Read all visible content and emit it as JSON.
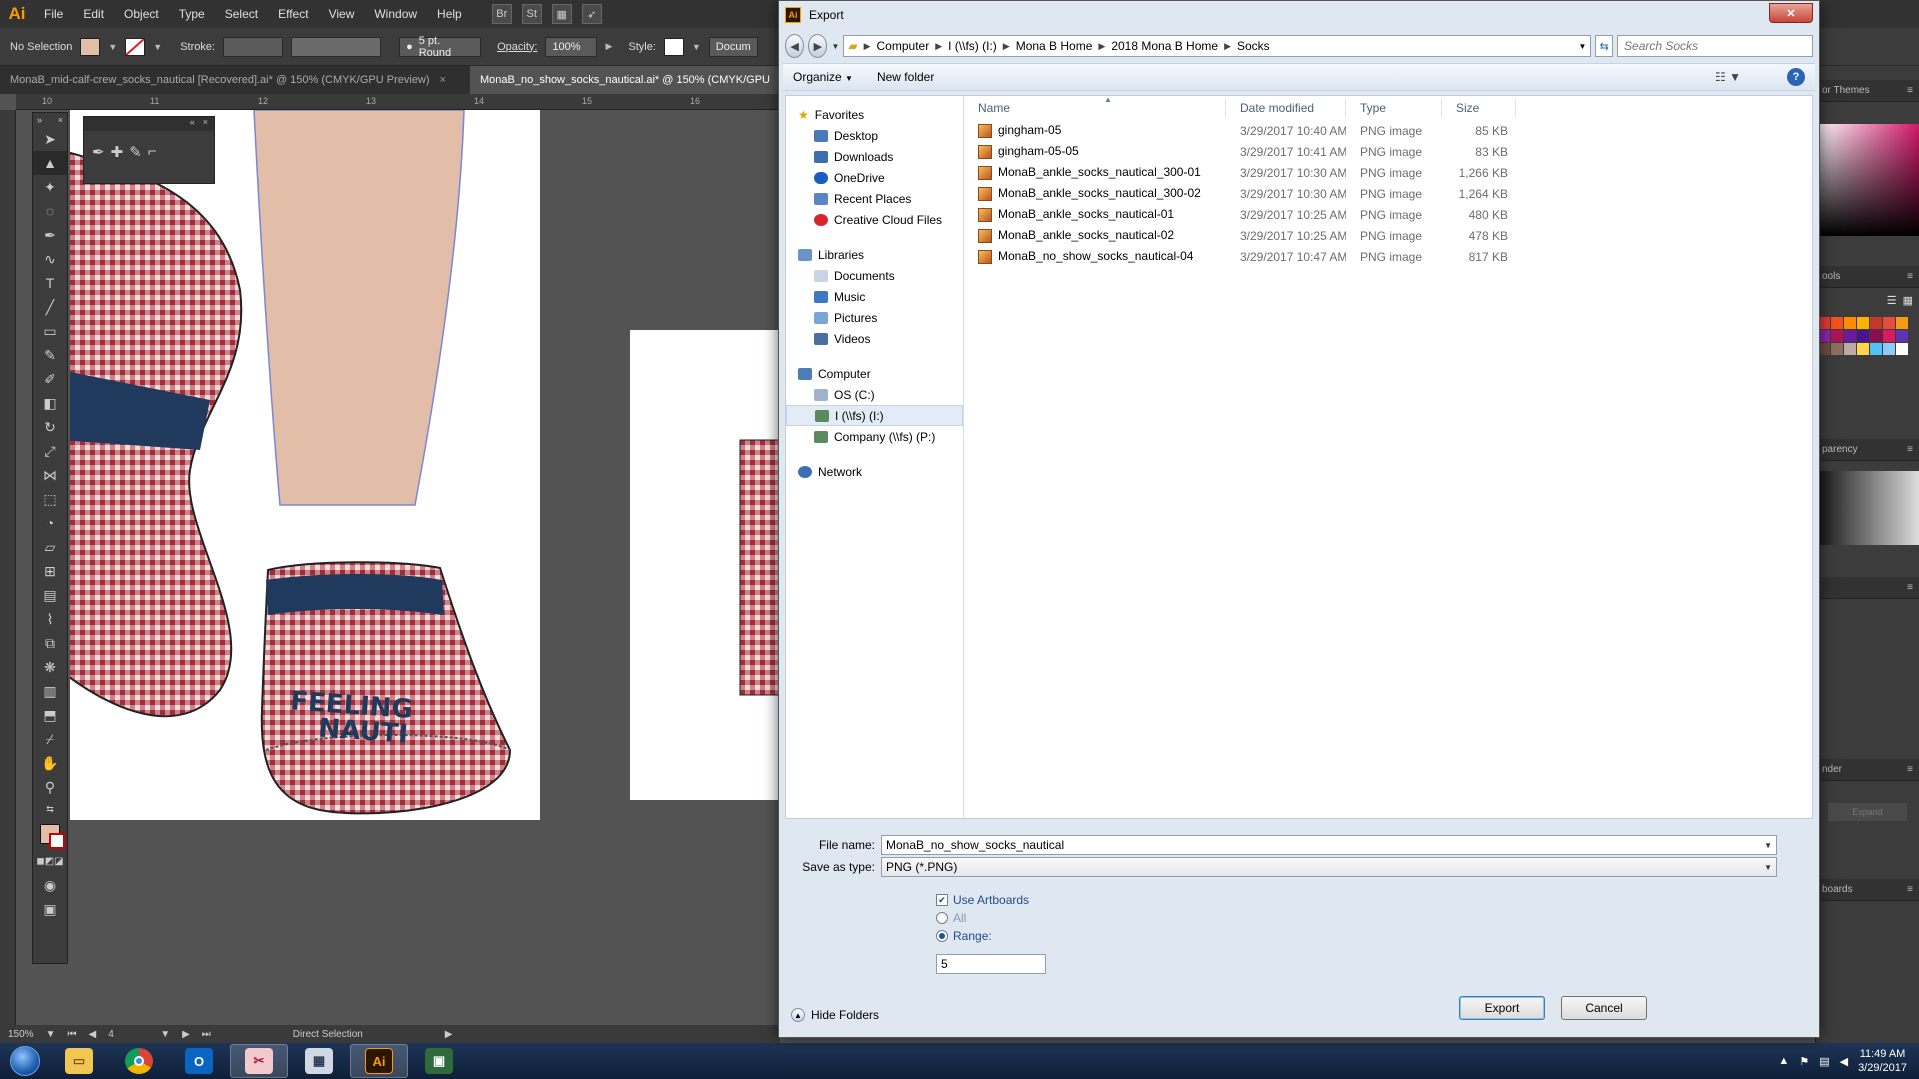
{
  "illustrator": {
    "logo": "Ai",
    "menus": [
      "File",
      "Edit",
      "Object",
      "Type",
      "Select",
      "Effect",
      "View",
      "Window",
      "Help"
    ],
    "bar_icons": [
      "Br",
      "St"
    ],
    "control": {
      "selection": "No Selection",
      "stroke_label": "Stroke:",
      "brush": "5 pt. Round",
      "opacity_label": "Opacity:",
      "opacity_value": "100%",
      "style_label": "Style:",
      "doc_label": "Docum"
    },
    "tabs": [
      {
        "label": "MonaB_mid-calf-crew_socks_nautical [Recovered].ai* @ 150% (CMYK/GPU Preview)"
      },
      {
        "label": "MonaB_no_show_socks_nautical.ai* @ 150% (CMYK/GPU"
      }
    ],
    "ruler_numbers": [
      "10",
      "11",
      "12",
      "13",
      "14",
      "15",
      "16"
    ],
    "artwork_text": [
      "FEELING",
      "NAUTI"
    ],
    "status": {
      "zoom": "150%",
      "artboard_number": "4",
      "tool_name": "Direct Selection"
    },
    "dock_panels": [
      "or Themes",
      "ools",
      "parency",
      "nder",
      "boards"
    ],
    "dock_expand": "Expand",
    "colors": {
      "gingham": "#b5454f",
      "cuff": "#1f3a5c",
      "skin": "#e2bea8",
      "app_bg": "#535353"
    }
  },
  "dialog": {
    "title": "Export",
    "app_icon": "Ai",
    "breadcrumb": [
      "Computer",
      "I (\\\\fs) (I:)",
      "Mona B Home",
      "2018 Mona B Home",
      "Socks"
    ],
    "search_placeholder": "Search Socks",
    "toolbar": {
      "organize": "Organize",
      "new_folder": "New folder"
    },
    "nav": {
      "favorites": {
        "label": "Favorites",
        "items": [
          "Desktop",
          "Downloads",
          "OneDrive",
          "Recent Places",
          "Creative Cloud Files"
        ]
      },
      "libraries": {
        "label": "Libraries",
        "items": [
          "Documents",
          "Music",
          "Pictures",
          "Videos"
        ]
      },
      "computer": {
        "label": "Computer",
        "items": [
          "OS (C:)",
          "I (\\\\fs) (I:)",
          "Company (\\\\fs) (P:)"
        ]
      },
      "network": {
        "label": "Network"
      }
    },
    "columns": [
      "Name",
      "Date modified",
      "Type",
      "Size"
    ],
    "files": [
      {
        "name": "gingham-05",
        "date": "3/29/2017 10:40 AM",
        "type": "PNG image",
        "size": "85 KB"
      },
      {
        "name": "gingham-05-05",
        "date": "3/29/2017 10:41 AM",
        "type": "PNG image",
        "size": "83 KB"
      },
      {
        "name": "MonaB_ankle_socks_nautical_300-01",
        "date": "3/29/2017 10:30 AM",
        "type": "PNG image",
        "size": "1,266 KB"
      },
      {
        "name": "MonaB_ankle_socks_nautical_300-02",
        "date": "3/29/2017 10:30 AM",
        "type": "PNG image",
        "size": "1,264 KB"
      },
      {
        "name": "MonaB_ankle_socks_nautical-01",
        "date": "3/29/2017 10:25 AM",
        "type": "PNG image",
        "size": "480 KB"
      },
      {
        "name": "MonaB_ankle_socks_nautical-02",
        "date": "3/29/2017 10:25 AM",
        "type": "PNG image",
        "size": "478 KB"
      },
      {
        "name": "MonaB_no_show_socks_nautical-04",
        "date": "3/29/2017 10:47 AM",
        "type": "PNG image",
        "size": "817 KB"
      }
    ],
    "form": {
      "filename_label": "File name:",
      "filename_value": "MonaB_no_show_socks_nautical",
      "savetype_label": "Save as type:",
      "savetype_value": "PNG (*.PNG)",
      "use_artboards": "Use Artboards",
      "all": "All",
      "range": "Range:",
      "range_value": "5"
    },
    "hide_folders": "Hide Folders",
    "buttons": {
      "export": "Export",
      "cancel": "Cancel"
    }
  },
  "taskbar": {
    "time": "11:49 AM",
    "date": "3/29/2017",
    "apps": [
      "explorer",
      "chrome",
      "outlook",
      "snipping",
      "calculator",
      "illustrator",
      "app"
    ]
  }
}
